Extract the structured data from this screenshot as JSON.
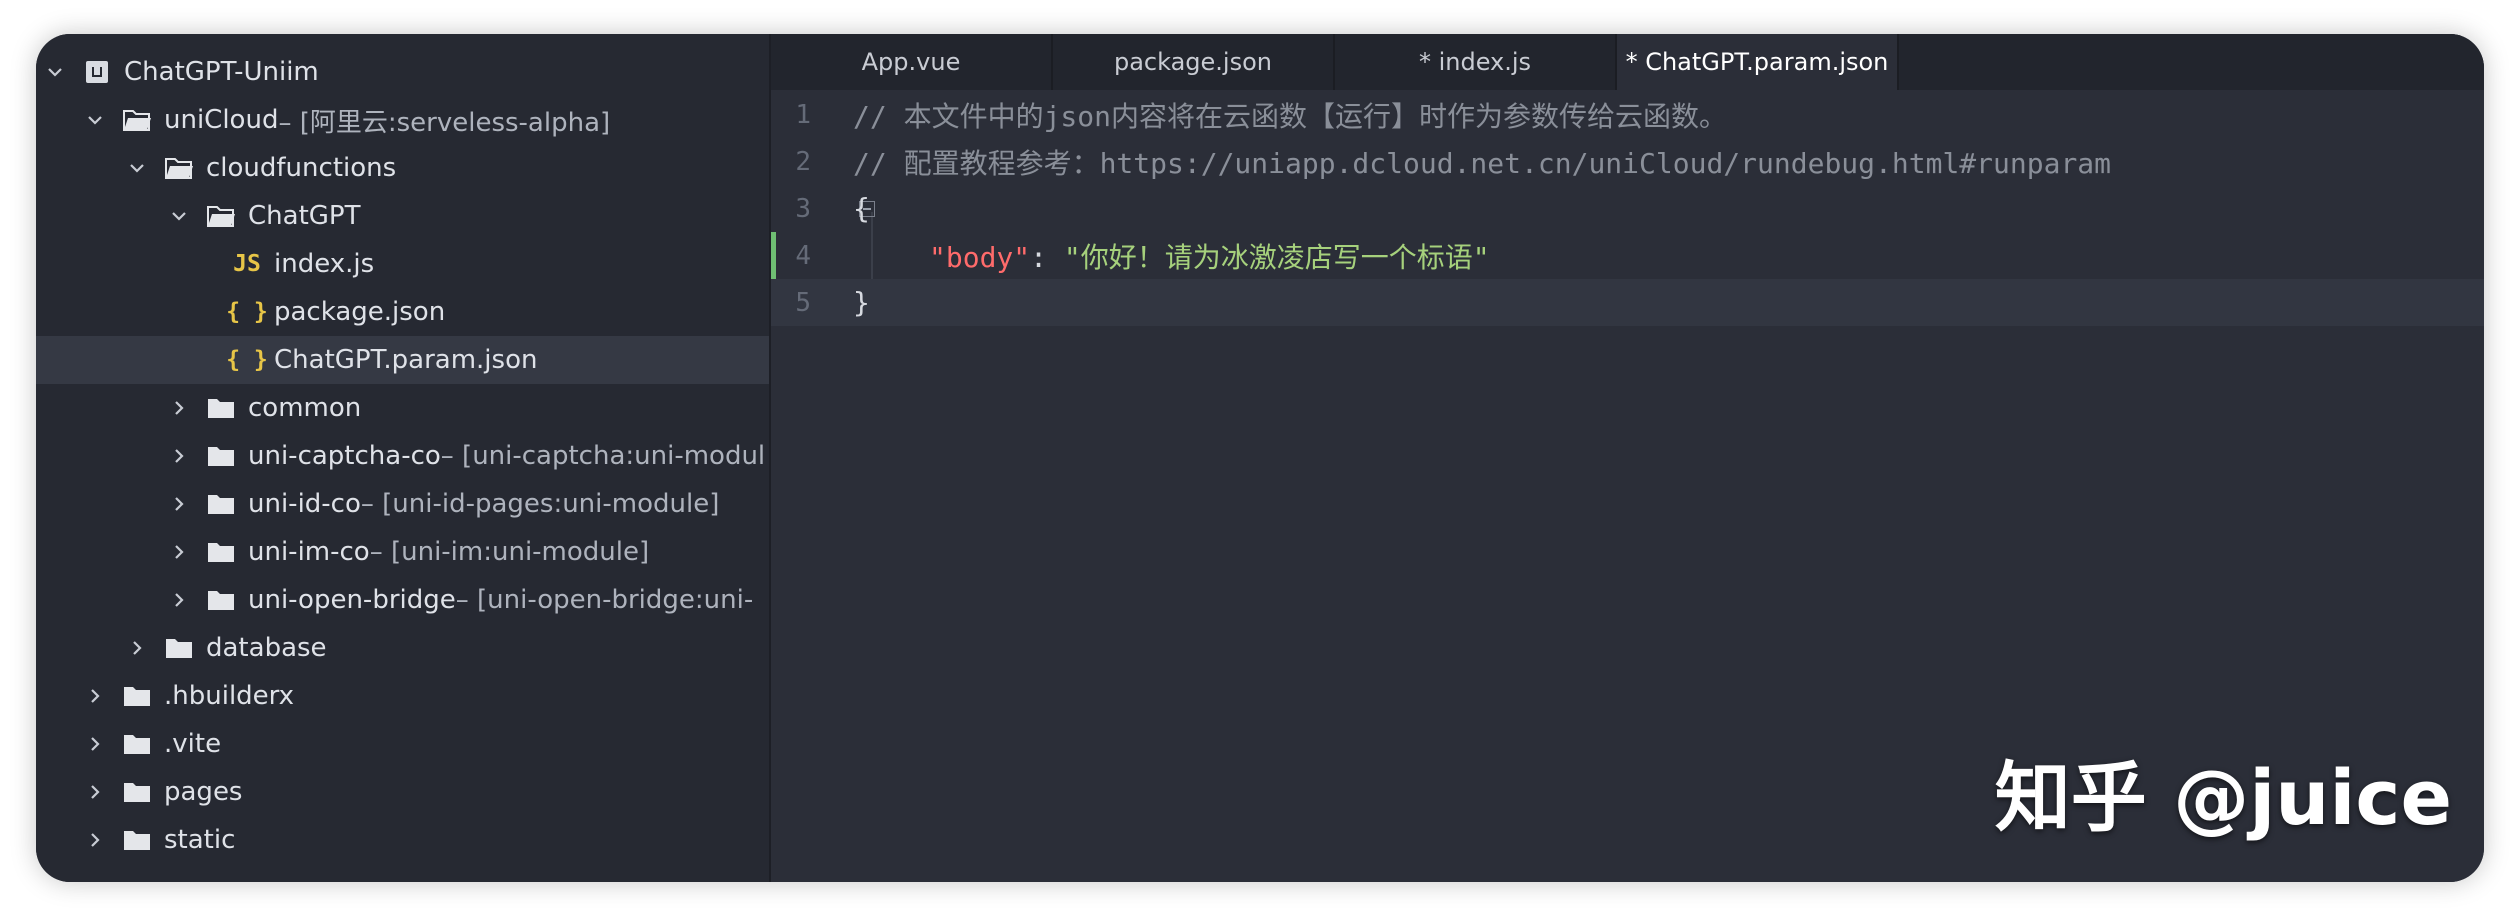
{
  "sidebar": {
    "items": [
      {
        "label": "ChatGPT-Uniim",
        "suffix": "",
        "icon": "project-icon",
        "expanded": true
      },
      {
        "label": "uniCloud",
        "suffix": " – [阿里云:serveless-alpha]",
        "icon": "folder-open-icon",
        "expanded": true
      },
      {
        "label": "cloudfunctions",
        "suffix": "",
        "icon": "folder-open-icon",
        "expanded": true
      },
      {
        "label": "ChatGPT",
        "suffix": "",
        "icon": "folder-open-icon",
        "expanded": true
      },
      {
        "label": "index.js",
        "suffix": "",
        "icon": "js-file-icon",
        "glyph": "JS"
      },
      {
        "label": "package.json",
        "suffix": "",
        "icon": "json-file-icon",
        "glyph": "{ }"
      },
      {
        "label": "ChatGPT.param.json",
        "suffix": "",
        "icon": "json-file-icon",
        "glyph": "{ }",
        "selected": true
      },
      {
        "label": "common",
        "suffix": "",
        "icon": "folder-icon",
        "expanded": false
      },
      {
        "label": "uni-captcha-co",
        "suffix": " – [uni-captcha:uni-modul",
        "icon": "folder-icon",
        "expanded": false
      },
      {
        "label": "uni-id-co",
        "suffix": " – [uni-id-pages:uni-module]",
        "icon": "folder-icon",
        "expanded": false
      },
      {
        "label": "uni-im-co",
        "suffix": " – [uni-im:uni-module]",
        "icon": "folder-icon",
        "expanded": false
      },
      {
        "label": "uni-open-bridge",
        "suffix": " – [uni-open-bridge:uni-",
        "icon": "folder-icon",
        "expanded": false
      },
      {
        "label": "database",
        "suffix": "",
        "icon": "folder-icon",
        "expanded": false
      },
      {
        "label": ".hbuilderx",
        "suffix": "",
        "icon": "folder-icon",
        "expanded": false
      },
      {
        "label": ".vite",
        "suffix": "",
        "icon": "folder-icon",
        "expanded": false
      },
      {
        "label": "pages",
        "suffix": "",
        "icon": "folder-icon",
        "expanded": false
      },
      {
        "label": "static",
        "suffix": "",
        "icon": "folder-icon",
        "expanded": false
      }
    ]
  },
  "tabs": [
    {
      "label": "App.vue",
      "active": false
    },
    {
      "label": "package.json",
      "active": false
    },
    {
      "label": "* index.js",
      "active": false
    },
    {
      "label": "* ChatGPT.param.json",
      "active": true
    }
  ],
  "editor": {
    "line_numbers": [
      "1",
      "2",
      "3",
      "4",
      "5"
    ],
    "line1": "// 本文件中的json内容将在云函数【运行】时作为参数传给云函数。",
    "line2": "// 配置教程参考：https://uniapp.dcloud.net.cn/uniCloud/rundebug.html#runparam",
    "line3": "{",
    "line4_key": "\"body\"",
    "line4_colon": ": ",
    "line4_value": "\"你好！请为冰激凌店写一个标语\"",
    "line5": "}"
  },
  "watermark": "知乎 @juice"
}
